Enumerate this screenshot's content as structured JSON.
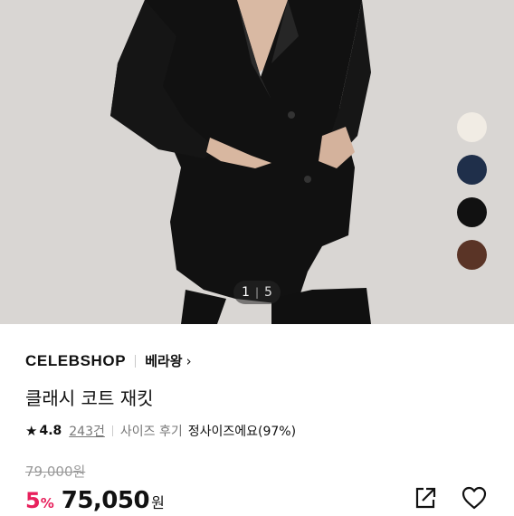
{
  "gallery": {
    "current": "1",
    "separator": "|",
    "total": "5",
    "swatches": [
      "#f1ece4",
      "#1f2f4a",
      "#111111",
      "#5a3426"
    ]
  },
  "product": {
    "brand": "CELEBSHOP",
    "seller": "베라왕",
    "seller_arrow": "›",
    "title": "클래시 코트 재킷",
    "rating_star": "★",
    "rating": "4.8",
    "review_count": "243건",
    "review_label": "사이즈 후기",
    "size_note": "정사이즈에요(97%)",
    "original_price": "79,000원",
    "discount": "5",
    "discount_unit": "%",
    "price": "75,050",
    "currency": "원"
  },
  "icons": {
    "share": "share-icon",
    "like": "heart-icon"
  },
  "colors": {
    "accent": "#e8205c"
  }
}
